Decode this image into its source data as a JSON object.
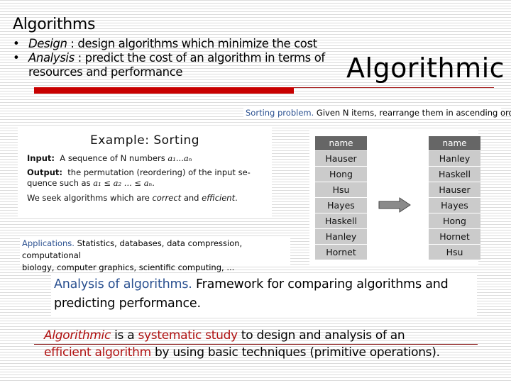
{
  "slide": {
    "title": "Algorithms",
    "bullets": [
      {
        "term": "Design",
        "text": " : design algorithms which minimize the cost"
      },
      {
        "term": "Analysis",
        "text": " : predict the cost of an algorithm in terms of",
        "continuation": "resources and performance"
      }
    ],
    "big_word": "Algorithmic",
    "accent_color": "#c80000"
  },
  "sorting_problem": {
    "label": "Sorting problem.",
    "text": "Given N items, rearrange them in ascending order."
  },
  "example": {
    "title": "Example:  Sorting",
    "input_label": "Input:",
    "input_text": "A sequence of N numbers ",
    "input_math": "a₁...aₙ",
    "output_label": "Output:",
    "output_text": "the permutation (reordering) of the input se-",
    "output_text2": "quence such as ",
    "output_math": "a₁ ≤ a₂ ... ≤ aₙ.",
    "seek_text": "We seek algorithms which are ",
    "seek_correct": "correct",
    "seek_and": " and ",
    "seek_efficient": "efficient",
    "seek_end": "."
  },
  "applications": {
    "label": "Applications.",
    "text": "Statistics, databases, data compression, computational",
    "text2": "biology, computer graphics, scientific computing,  ..."
  },
  "tables": {
    "header": "name",
    "unsorted": [
      "Hauser",
      "Hong",
      "Hsu",
      "Hayes",
      "Haskell",
      "Hanley",
      "Hornet"
    ],
    "sorted": [
      "Hanley",
      "Haskell",
      "Hauser",
      "Hayes",
      "Hong",
      "Hornet",
      "Hsu"
    ],
    "arrow_icon": "right-arrow-icon"
  },
  "analysis": {
    "label": "Analysis of algorithms.",
    "text": "Framework for comparing algorithms and",
    "text2": "predicting performance."
  },
  "summary": {
    "w1": "Algorithmic",
    "t1": " is a ",
    "w2": "systematic study",
    "t2": " to design and analysis of an",
    "w3": "efficient algorithm",
    "t3": " by using basic techniques (primitive operations)."
  }
}
